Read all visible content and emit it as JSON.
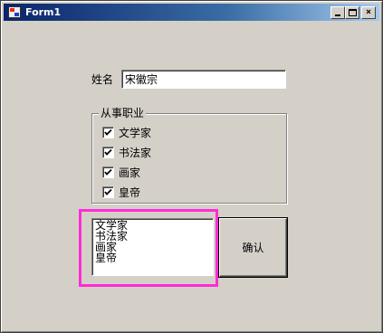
{
  "window": {
    "title": "Form1",
    "controls": {
      "minimize_icon": "minimize-icon",
      "maximize_icon": "maximize-icon",
      "close_symbol": "×"
    }
  },
  "form": {
    "name_label": "姓名",
    "name_value": "宋徽宗",
    "occupation_group": {
      "legend": "从事职业",
      "options": [
        {
          "label": "文学家",
          "checked": true
        },
        {
          "label": "书法家",
          "checked": true
        },
        {
          "label": "画家",
          "checked": true
        },
        {
          "label": "皇帝",
          "checked": true
        }
      ]
    },
    "result_list": [
      "文学家",
      "书法家",
      "画家",
      "皇帝"
    ],
    "confirm_label": "确认"
  },
  "colors": {
    "highlight": "#ff2cd6",
    "titlebar_start": "#0a246a",
    "titlebar_end": "#a6caf0",
    "face": "#d4d0c8"
  }
}
